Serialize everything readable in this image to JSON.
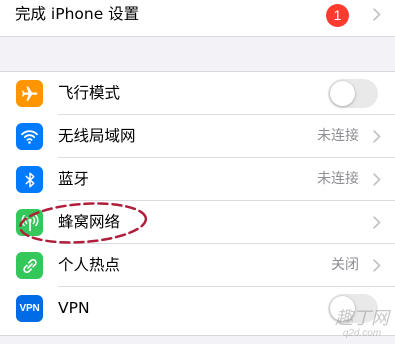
{
  "setup_section": {
    "label": "完成 iPhone 设置",
    "badge_count": "1",
    "badge_color": "#ff3b30"
  },
  "settings": [
    {
      "label": "飞行模式",
      "icon": "airplane-icon",
      "icon_color": "#ff9500",
      "control": "toggle",
      "toggle_on": false
    },
    {
      "label": "无线局域网",
      "icon": "wifi-icon",
      "icon_color": "#007aff",
      "control": "value",
      "value": "未连接"
    },
    {
      "label": "蓝牙",
      "icon": "bluetooth-icon",
      "icon_color": "#007aff",
      "control": "value",
      "value": "未连接"
    },
    {
      "label": "蜂窝网络",
      "icon": "cellular-antenna-icon",
      "icon_color": "#34c759",
      "control": "chevron"
    },
    {
      "label": "个人热点",
      "icon": "personal-hotspot-icon",
      "icon_color": "#34c759",
      "control": "value",
      "value": "关闭"
    },
    {
      "label": "VPN",
      "icon": "vpn-icon",
      "icon_text": "VPN",
      "icon_color": "#006be6",
      "control": "toggle",
      "toggle_on": false
    }
  ],
  "annotation": {
    "shape": "dashed-ellipse",
    "color": "#b01e3c",
    "highlights": "蜂窝网络"
  },
  "watermark": {
    "line1": "趣丁网",
    "line2": "q2d.com"
  }
}
